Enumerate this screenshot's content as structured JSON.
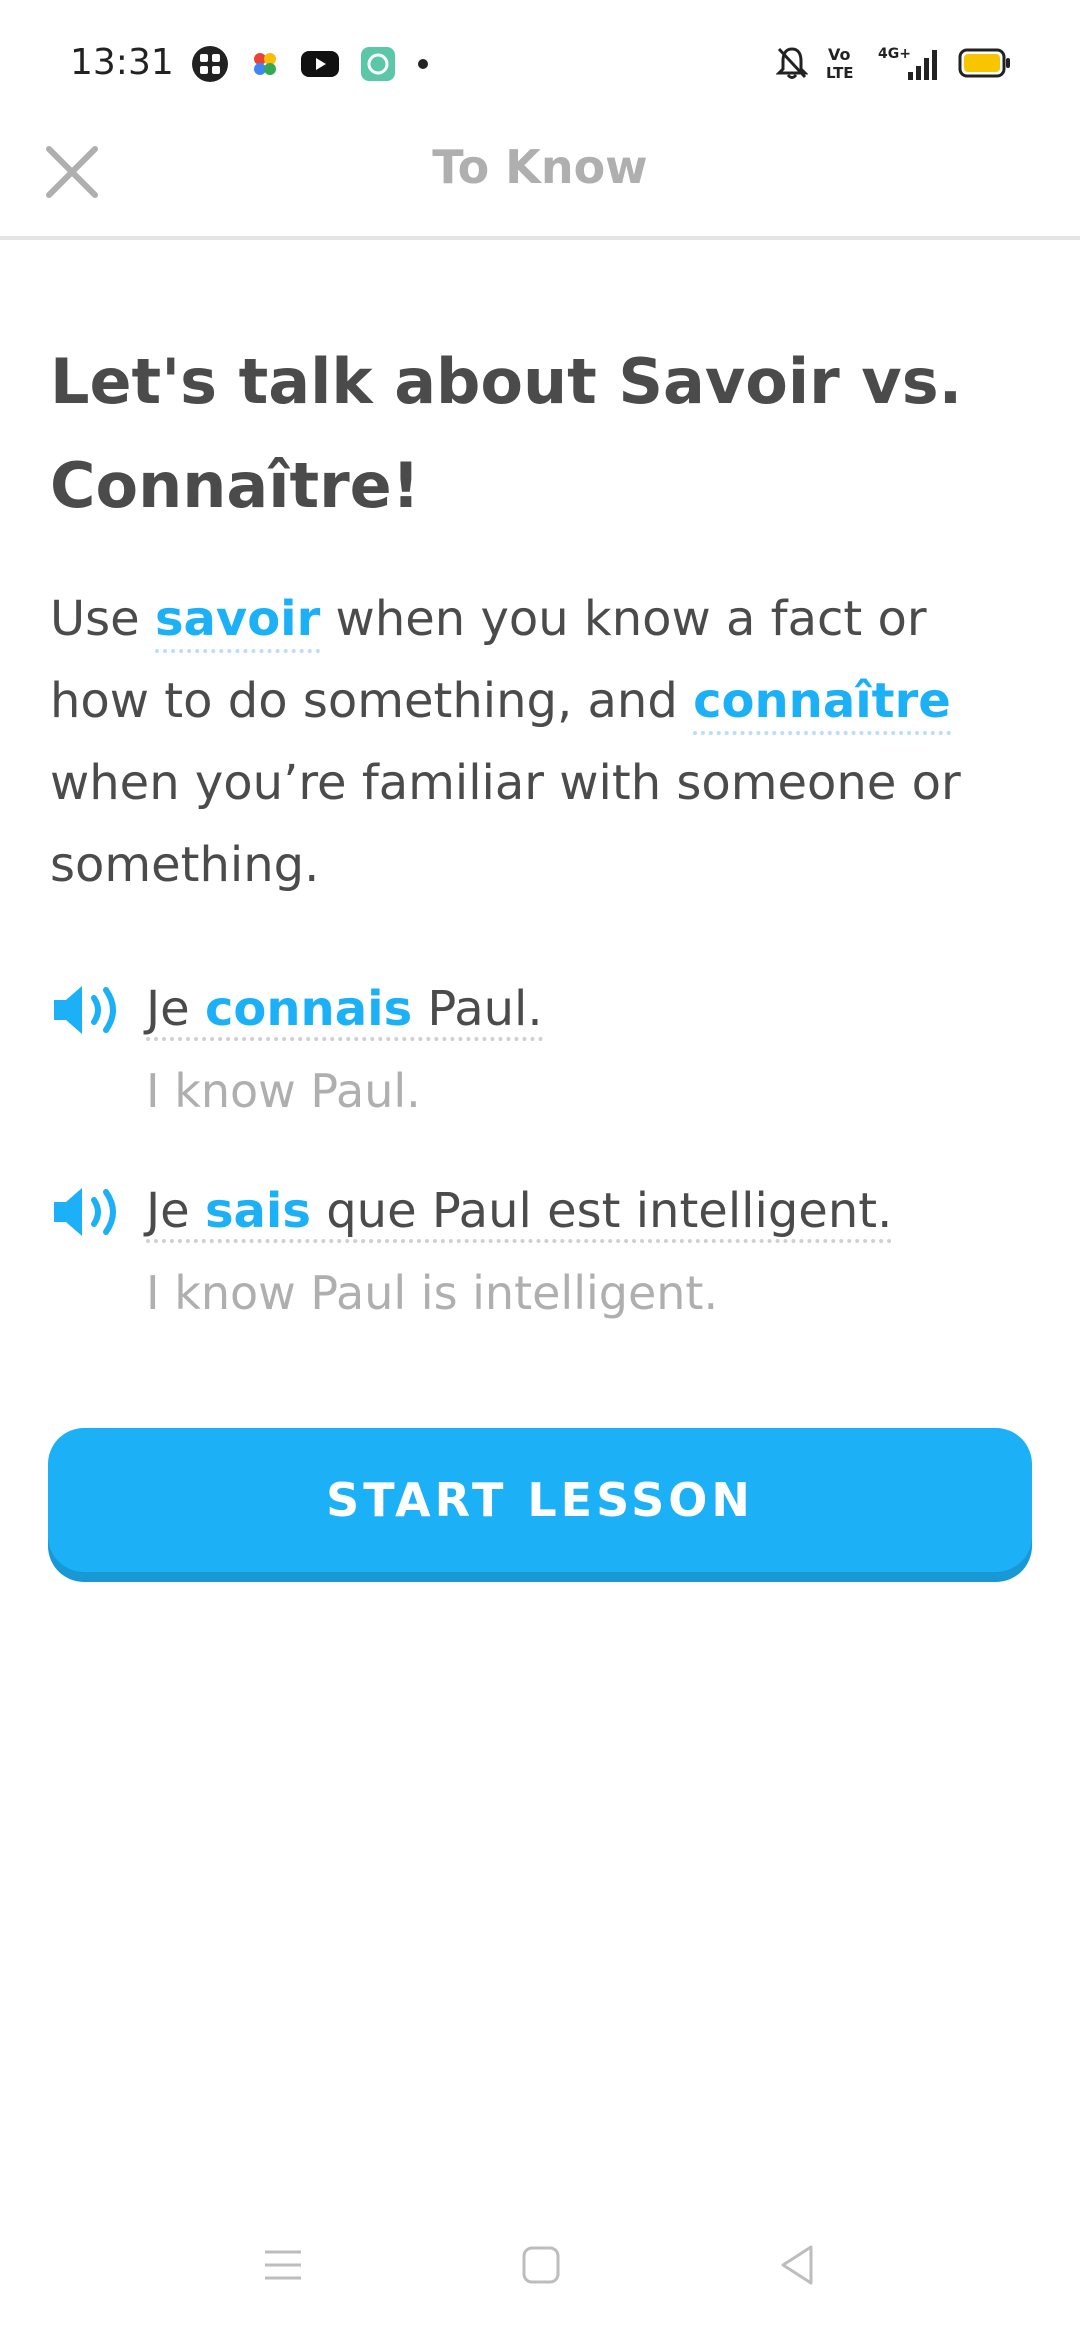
{
  "status_bar": {
    "time": "13:31",
    "left_icons": [
      "grid-app-icon",
      "pinwheel-icon",
      "youtube-icon",
      "app-badge-icon",
      "dot-icon"
    ],
    "right_icons": [
      "bell-muted-icon",
      "volte-icon",
      "signal-4g-icon",
      "battery-icon"
    ],
    "volte_text": "Vo\nLTE",
    "network_text": "4G+"
  },
  "header": {
    "title": "To Know"
  },
  "content": {
    "headline": "Let's talk about Savoir vs. Connaître!",
    "intro": {
      "part1": "Use ",
      "kw1": "savoir",
      "part2": " when you know a fact or how to do something, and ",
      "kw2": "connaître",
      "part3": " when you’re familiar with someone or something."
    },
    "examples": [
      {
        "fr_pre": "Je ",
        "fr_kw": "connais",
        "fr_post": " Paul.",
        "en": "I know Paul."
      },
      {
        "fr_pre": "Je ",
        "fr_kw": "sais",
        "fr_post": " que Paul est intelligent.",
        "en": "I know Paul is intelligent."
      }
    ]
  },
  "actions": {
    "start_lesson": "START LESSON"
  },
  "colors": {
    "accent": "#1cb0f6",
    "accent_shadow": "#1899d6",
    "text": "#4b4b4b",
    "muted": "#afafaf",
    "battery": "#f7c600"
  }
}
